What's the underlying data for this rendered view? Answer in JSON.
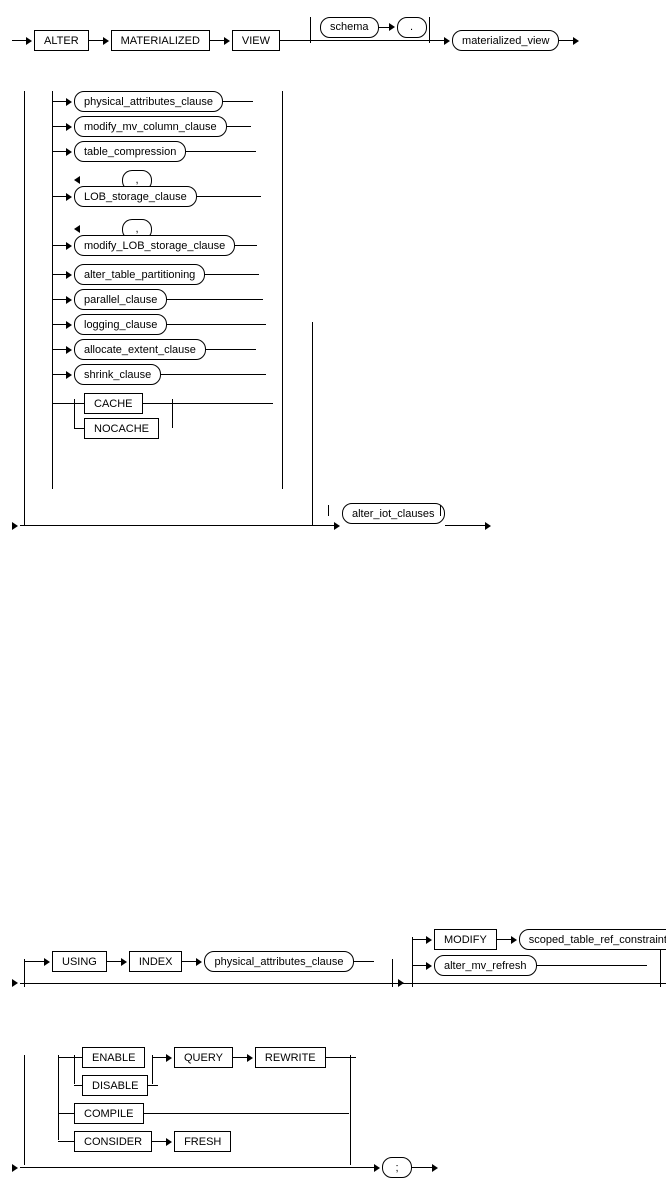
{
  "diagram_title": "ALTER MATERIALIZED VIEW",
  "line1": {
    "alter": "ALTER",
    "materialized": "MATERIALIZED",
    "view": "VIEW",
    "schema": "schema",
    "dot": ".",
    "mv": "materialized_view"
  },
  "block2": {
    "phys_attr": "physical_attributes_clause",
    "modify_mv_col": "modify_mv_column_clause",
    "table_comp": "table_compression",
    "lob_sep": ",",
    "lob_storage": "LOB_storage_clause",
    "mod_lob_sep": ",",
    "modify_lob": "modify_LOB_storage_clause",
    "alter_tbl_part": "alter_table_partitioning",
    "parallel": "parallel_clause",
    "logging": "logging_clause",
    "alloc_extent": "allocate_extent_clause",
    "shrink": "shrink_clause",
    "cache": "CACHE",
    "nocache": "NOCACHE",
    "alter_iot": "alter_iot_clauses"
  },
  "block3": {
    "using": "USING",
    "index": "INDEX",
    "phys_attr": "physical_attributes_clause",
    "modify": "MODIFY",
    "scoped": "scoped_table_ref_constraint",
    "alter_mv_refresh": "alter_mv_refresh"
  },
  "block4": {
    "enable": "ENABLE",
    "disable": "DISABLE",
    "query": "QUERY",
    "rewrite": "REWRITE",
    "compile": "COMPILE",
    "consider": "CONSIDER",
    "fresh": "FRESH",
    "semi": ";"
  }
}
